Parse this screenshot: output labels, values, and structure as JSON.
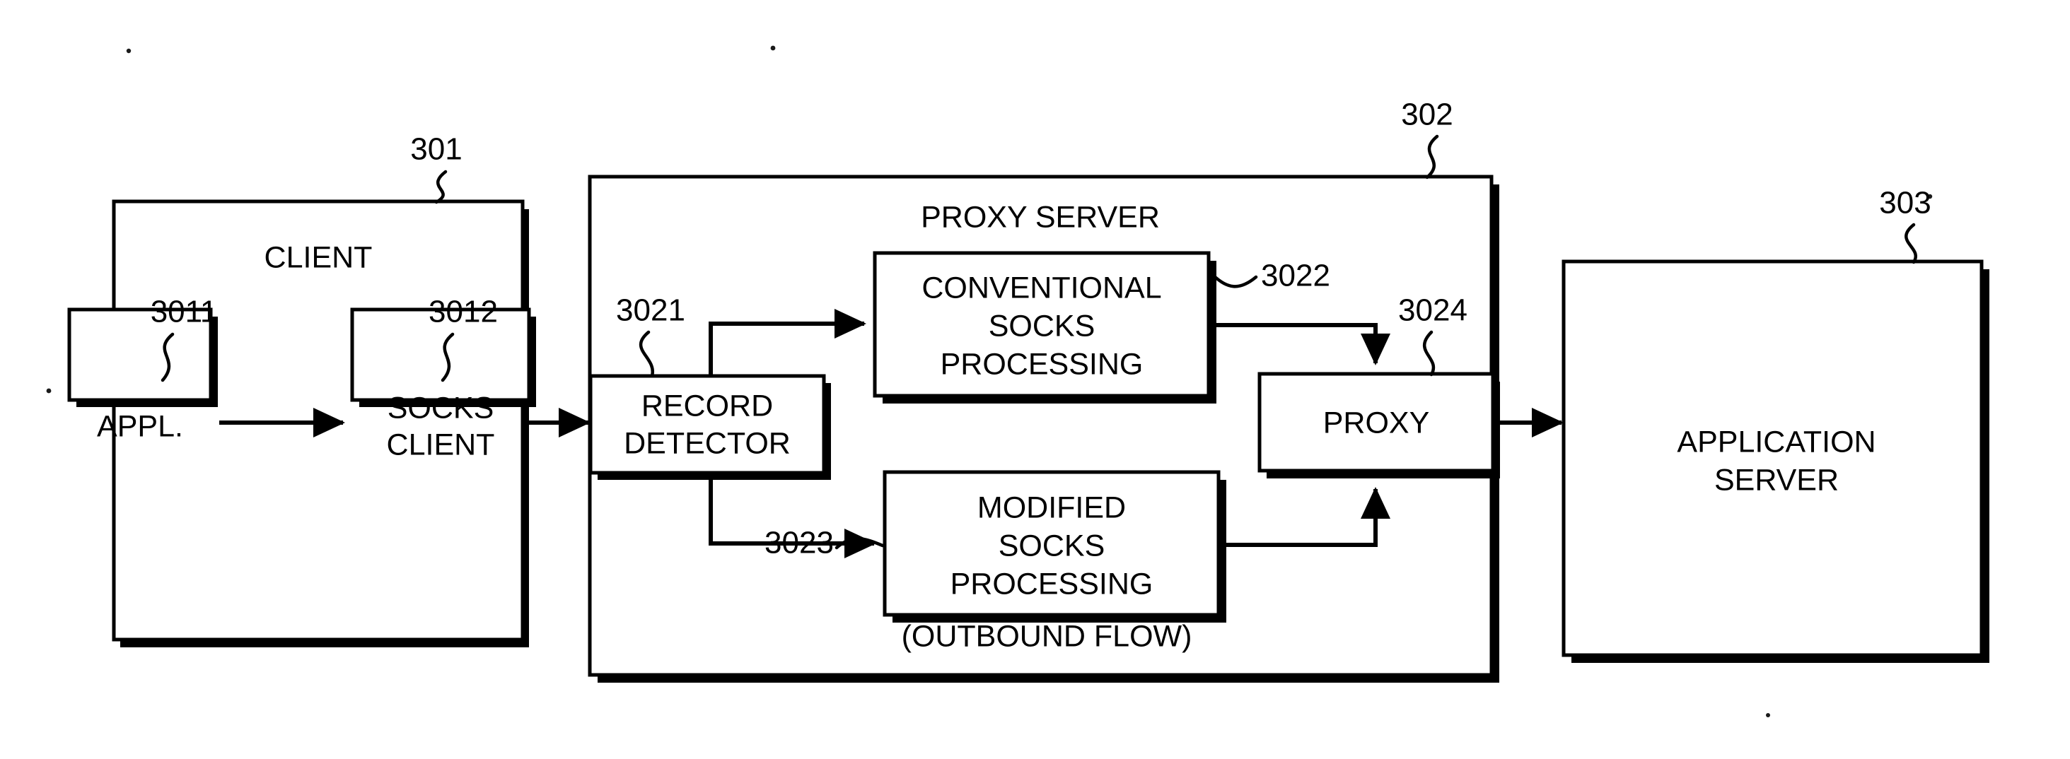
{
  "figure": {
    "type": "patent-block-diagram",
    "background_color": "#ffffff",
    "line_color": "#000000"
  },
  "blocks": {
    "client": {
      "label": "CLIENT",
      "ref": "301",
      "children": {
        "appl": {
          "label": "APPL.",
          "ref": "3011"
        },
        "socks_client": {
          "label_line1": "SOCKS",
          "label_line2": "CLIENT",
          "ref": "3012"
        }
      }
    },
    "proxy_server": {
      "label": "PROXY SERVER",
      "ref": "302",
      "footnote": "(OUTBOUND FLOW)",
      "children": {
        "record_detector": {
          "label_line1": "RECORD",
          "label_line2": "DETECTOR",
          "ref": "3021"
        },
        "conventional_socks": {
          "label_line1": "CONVENTIONAL",
          "label_line2": "SOCKS",
          "label_line3": "PROCESSING",
          "ref": "3022"
        },
        "modified_socks": {
          "label_line1": "MODIFIED",
          "label_line2": "SOCKS",
          "label_line3": "PROCESSING",
          "ref": "3023"
        },
        "proxy": {
          "label": "PROXY",
          "ref": "3024"
        }
      }
    },
    "application_server": {
      "label_line1": "APPLICATION",
      "label_line2": "SERVER",
      "ref": "303"
    }
  },
  "connections": [
    {
      "name": "appl-to-socks-client",
      "from": "appl",
      "to": "socks_client",
      "arrow": true
    },
    {
      "name": "socks-client-to-record-detector",
      "from": "socks_client",
      "to": "record_detector",
      "arrow": true
    },
    {
      "name": "record-detector-to-conventional-socks",
      "from": "record_detector",
      "to": "conventional_socks",
      "arrow": true
    },
    {
      "name": "record-detector-to-modified-socks",
      "from": "record_detector",
      "to": "modified_socks",
      "arrow": true
    },
    {
      "name": "conventional-socks-to-proxy",
      "from": "conventional_socks",
      "to": "proxy",
      "arrow": true
    },
    {
      "name": "modified-socks-to-proxy",
      "from": "modified_socks",
      "to": "proxy",
      "arrow": true
    },
    {
      "name": "proxy-to-application-server",
      "from": "proxy",
      "to": "application_server",
      "arrow": true
    }
  ]
}
